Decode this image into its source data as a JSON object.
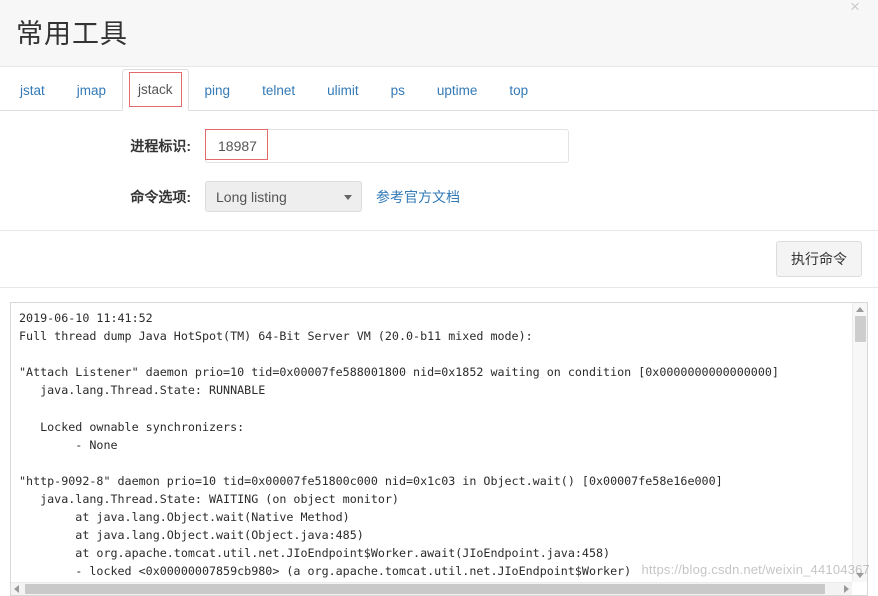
{
  "window": {
    "title": "常用工具",
    "close_icon": "close-icon",
    "close_label": "×"
  },
  "tabs": {
    "active": "jstack",
    "items": [
      {
        "label": "jstat"
      },
      {
        "label": "jmap"
      },
      {
        "label": "jstack"
      },
      {
        "label": "ping"
      },
      {
        "label": "telnet"
      },
      {
        "label": "ulimit"
      },
      {
        "label": "ps"
      },
      {
        "label": "uptime"
      },
      {
        "label": "top"
      }
    ]
  },
  "form": {
    "pid": {
      "label": "进程标识:",
      "value": "18987",
      "placeholder": ""
    },
    "options": {
      "label": "命令选项:",
      "selected": "Long listing",
      "choices": [
        "Long listing"
      ],
      "caret_icon": "chevron-down-icon",
      "doc_link": "参考官方文档"
    }
  },
  "actions": {
    "execute_label": "执行命令"
  },
  "console": {
    "output": "2019-06-10 11:41:52\nFull thread dump Java HotSpot(TM) 64-Bit Server VM (20.0-b11 mixed mode):\n\n\"Attach Listener\" daemon prio=10 tid=0x00007fe588001800 nid=0x1852 waiting on condition [0x0000000000000000]\n   java.lang.Thread.State: RUNNABLE\n\n   Locked ownable synchronizers:\n        - None\n\n\"http-9092-8\" daemon prio=10 tid=0x00007fe51800c000 nid=0x1c03 in Object.wait() [0x00007fe58e16e000]\n   java.lang.Thread.State: WAITING (on object monitor)\n        at java.lang.Object.wait(Native Method)\n        at java.lang.Object.wait(Object.java:485)\n        at org.apache.tomcat.util.net.JIoEndpoint$Worker.await(JIoEndpoint.java:458)\n        - locked <0x00000007859cb980> (a org.apache.tomcat.util.net.JIoEndpoint$Worker)",
    "scroll_up_icon": "arrow-up-icon",
    "scroll_down_icon": "arrow-down-icon",
    "scroll_left_icon": "arrow-left-icon",
    "scroll_right_icon": "arrow-right-icon"
  },
  "watermark": "https://blog.csdn.net/weixin_44104367",
  "colors": {
    "link": "#337ab7",
    "annotation": "#e36a6a",
    "header_bg": "#f7f7f7"
  }
}
